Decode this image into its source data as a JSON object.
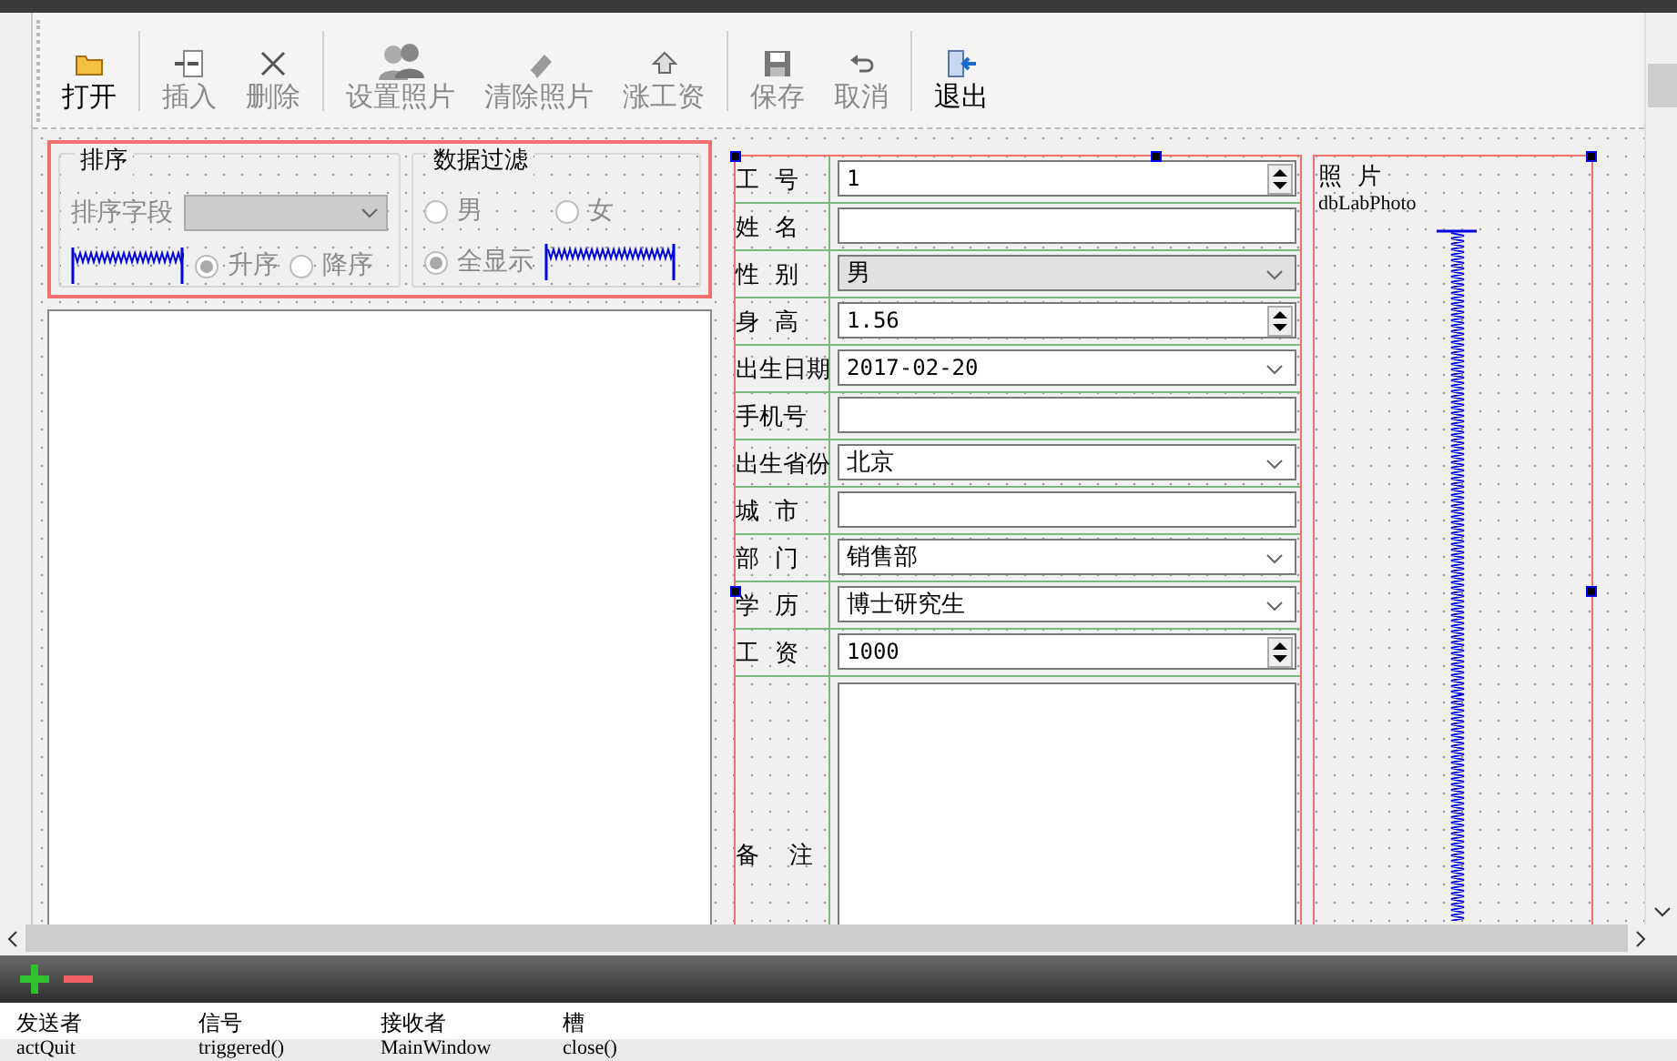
{
  "toolbar": [
    {
      "label": "打开",
      "disabled": false
    },
    {
      "label": "插入",
      "disabled": true
    },
    {
      "label": "删除",
      "disabled": true
    },
    {
      "label": "设置照片",
      "disabled": true
    },
    {
      "label": "清除照片",
      "disabled": true
    },
    {
      "label": "涨工资",
      "disabled": true
    },
    {
      "label": "保存",
      "disabled": true
    },
    {
      "label": "取消",
      "disabled": true
    },
    {
      "label": "退出",
      "disabled": false
    }
  ],
  "sort_group": {
    "title": "排序",
    "field_label": "排序字段",
    "disabled": true,
    "options": [
      {
        "label": "升序",
        "selected": true
      },
      {
        "label": "降序",
        "selected": false
      }
    ]
  },
  "filter_group": {
    "title": "数据过滤",
    "disabled": true,
    "options": [
      {
        "label": "男",
        "selected": false
      },
      {
        "label": "女",
        "selected": false
      },
      {
        "label": "全显示",
        "selected": true
      }
    ]
  },
  "form": {
    "fields": [
      {
        "label": "工  号",
        "kind": "spin",
        "value": "1"
      },
      {
        "label": "姓  名",
        "kind": "text"
      },
      {
        "label": "性  别",
        "kind": "combo",
        "value": "男"
      },
      {
        "label": "身  高",
        "kind": "spin",
        "value": "1.56"
      },
      {
        "label": "出生日期",
        "kind": "date",
        "value": "2017-02-20"
      },
      {
        "label": "手机号",
        "kind": "text"
      },
      {
        "label": "出生省份",
        "kind": "editcombo",
        "value": "北京"
      },
      {
        "label": "城  市",
        "kind": "text"
      },
      {
        "label": "部  门",
        "kind": "editcombo",
        "value": "销售部"
      },
      {
        "label": "学  历",
        "kind": "editcombo",
        "value": "博士研究生"
      },
      {
        "label": "工  资",
        "kind": "spin",
        "value": "1000"
      }
    ],
    "notes_label": "备    注"
  },
  "photo": {
    "label": "照  片",
    "text": "dbLabPhoto"
  },
  "signal_slot_editor": {
    "columns": [
      "发送者",
      "信号",
      "接收者",
      "槽"
    ],
    "rows": [
      [
        "actQuit",
        "triggered()",
        "MainWindow",
        "close()"
      ]
    ]
  }
}
